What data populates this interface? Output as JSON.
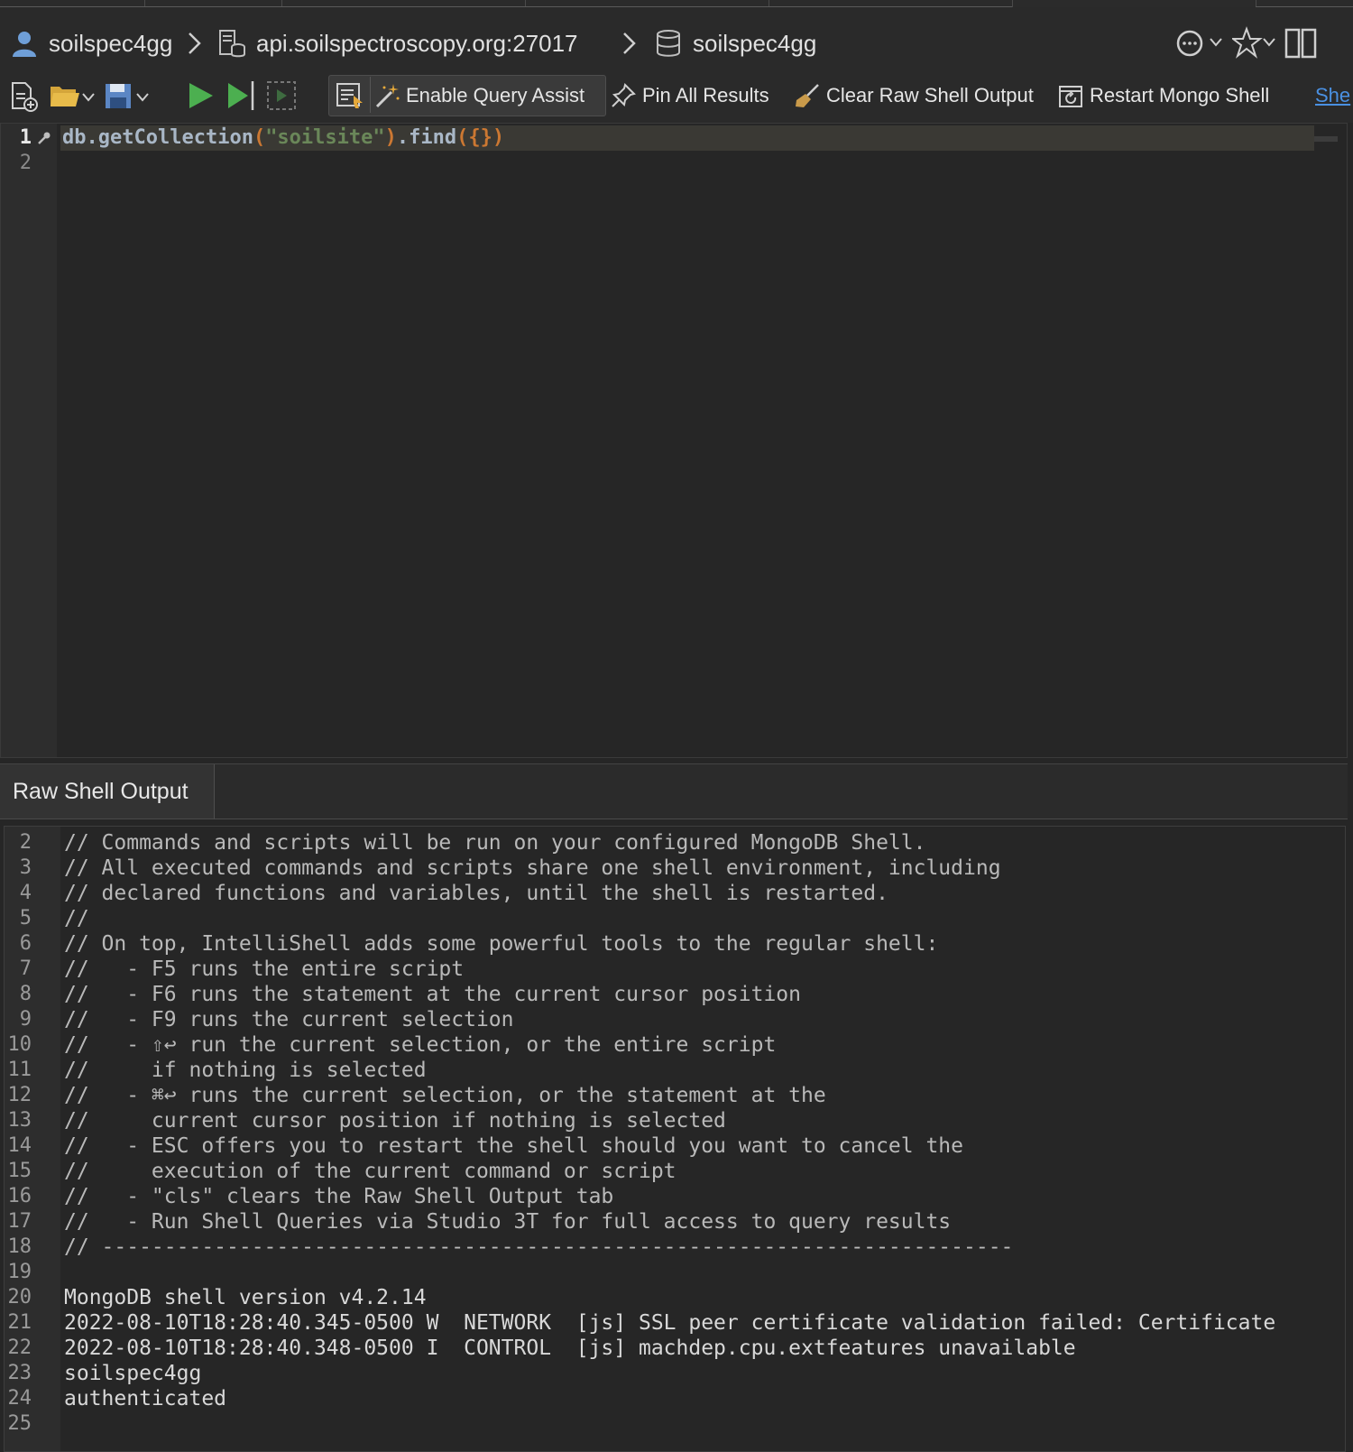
{
  "breadcrumb": {
    "user": "soilspec4gg",
    "server": "api.soilspectroscopy.org:27017",
    "database": "soilspec4gg"
  },
  "toolbar": {
    "enable_query_assist": "Enable Query Assist",
    "pin_all_results": "Pin All Results",
    "clear_raw_shell_output": "Clear Raw Shell Output",
    "restart_mongo_shell": "Restart Mongo Shell",
    "shell_link_partial": "She"
  },
  "editor": {
    "lines": [
      {
        "num": "1",
        "db": "db",
        "dot1": ".",
        "method": "getCollection",
        "open": "(",
        "arg": "\"soilsite\"",
        "close": ")",
        "dot2": ".",
        "find": "find",
        "args": "({})"
      },
      {
        "num": "2"
      }
    ]
  },
  "output": {
    "tab_label": "Raw Shell Output",
    "lines": [
      {
        "num": "2",
        "text": "// Commands and scripts will be run on your configured MongoDB Shell."
      },
      {
        "num": "3",
        "text": "// All executed commands and scripts share one shell environment, including"
      },
      {
        "num": "4",
        "text": "// declared functions and variables, until the shell is restarted."
      },
      {
        "num": "5",
        "text": "//"
      },
      {
        "num": "6",
        "text": "// On top, IntelliShell adds some powerful tools to the regular shell:"
      },
      {
        "num": "7",
        "text": "//   - F5 runs the entire script"
      },
      {
        "num": "8",
        "text": "//   - F6 runs the statement at the current cursor position"
      },
      {
        "num": "9",
        "text": "//   - F9 runs the current selection"
      },
      {
        "num": "10",
        "text": "//   - ⇧↩ run the current selection, or the entire script"
      },
      {
        "num": "11",
        "text": "//     if nothing is selected"
      },
      {
        "num": "12",
        "text": "//   - ⌘↩ runs the current selection, or the statement at the"
      },
      {
        "num": "13",
        "text": "//     current cursor position if nothing is selected"
      },
      {
        "num": "14",
        "text": "//   - ESC offers you to restart the shell should you want to cancel the"
      },
      {
        "num": "15",
        "text": "//     execution of the current command or script"
      },
      {
        "num": "16",
        "text": "//   - \"cls\" clears the Raw Shell Output tab"
      },
      {
        "num": "17",
        "text": "//   - Run Shell Queries via Studio 3T for full access to query results"
      },
      {
        "num": "18",
        "text": "// -------------------------------------------------------------------------"
      },
      {
        "num": "19",
        "text": ""
      },
      {
        "num": "20",
        "text": "MongoDB shell version v4.2.14"
      },
      {
        "num": "21",
        "text": "2022-08-10T18:28:40.345-0500 W  NETWORK  [js] SSL peer certificate validation failed: Certificate"
      },
      {
        "num": "22",
        "text": "2022-08-10T18:28:40.348-0500 I  CONTROL  [js] machdep.cpu.extfeatures unavailable"
      },
      {
        "num": "23",
        "text": "soilspec4gg"
      },
      {
        "num": "24",
        "text": "authenticated"
      },
      {
        "num": "25",
        "text": ""
      }
    ]
  },
  "icons": {
    "user": "user-icon",
    "server": "server-icon",
    "database": "database-icon",
    "history": "history-icon",
    "favorite": "star-icon",
    "layout": "split-layout-icon",
    "new_file": "new-file-icon",
    "open_folder": "open-folder-icon",
    "save": "save-icon",
    "run": "play-icon",
    "run_to_cursor": "step-icon",
    "run_selection": "run-selection-icon",
    "query_assist_panel": "query-assist-panel-icon",
    "magic_wand": "magic-wand-icon",
    "pin": "pin-icon",
    "broom": "broom-icon",
    "restart": "restart-icon"
  },
  "colors": {
    "background": "#262626",
    "string": "#6a8759",
    "punctuation": "#cc7832",
    "link": "#4a90e2",
    "run_green": "#4caf50"
  }
}
